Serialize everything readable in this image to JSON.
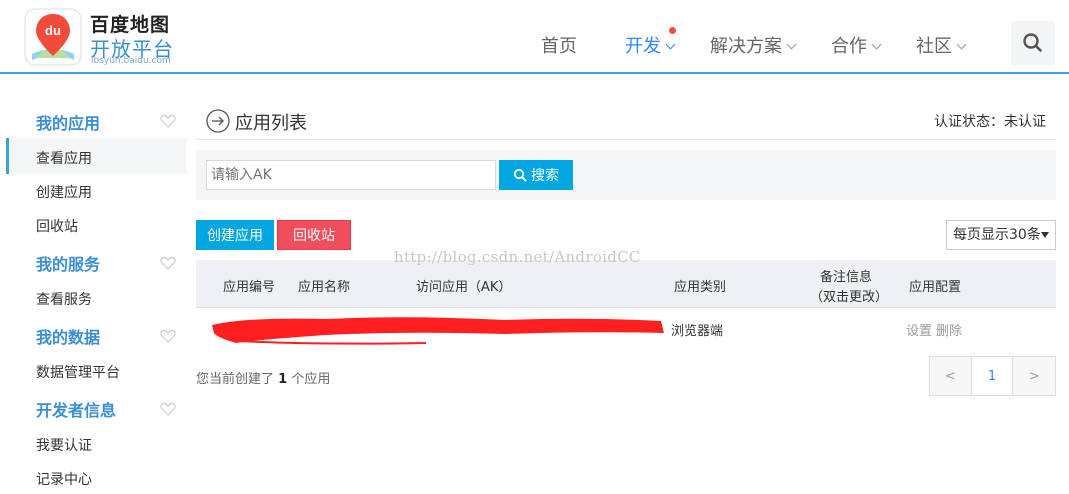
{
  "logo": {
    "title": "百度地图",
    "subtitle": "开放平台",
    "url": "lbsyun.baidu.com",
    "badge": "du"
  },
  "nav": {
    "items": [
      {
        "label": "首页"
      },
      {
        "label": "开发"
      },
      {
        "label": "解决方案"
      },
      {
        "label": "合作"
      },
      {
        "label": "社区"
      }
    ],
    "active_index": 1,
    "accent": "#3385ff"
  },
  "sidebar": {
    "groups": [
      {
        "title": "我的应用",
        "items": [
          "查看应用",
          "创建应用",
          "回收站"
        ]
      },
      {
        "title": "我的服务",
        "items": [
          "查看服务"
        ]
      },
      {
        "title": "我的数据",
        "items": [
          "数据管理平台"
        ]
      },
      {
        "title": "开发者信息",
        "items": [
          "我要认证",
          "记录中心"
        ]
      }
    ]
  },
  "main": {
    "title": "应用列表",
    "cert_status": "认证状态：未认证",
    "search": {
      "placeholder": "请输入AK",
      "button": "搜索"
    },
    "buttons": {
      "create": "创建应用",
      "recycle": "回收站"
    },
    "per_page": "每页显示30条",
    "watermark": "http://blog.csdn.net/AndroidCC",
    "table": {
      "headers": [
        "应用编号",
        "应用名称",
        "访问应用（AK）",
        "应用类别",
        "备注信息",
        "（双击更改）",
        "应用配置"
      ],
      "rows": [
        {
          "category": "浏览器端",
          "ops": [
            "设置",
            "删除"
          ]
        }
      ]
    },
    "summary": {
      "prefix": "您当前创建了",
      "count": "1",
      "suffix": "个应用"
    },
    "pager": {
      "prev": "<",
      "current": "1",
      "next": ">"
    }
  },
  "colors": {
    "brand_blue": "#00a7e0",
    "danger": "#f24d5c",
    "sidebar_title": "#3a8fd2"
  }
}
